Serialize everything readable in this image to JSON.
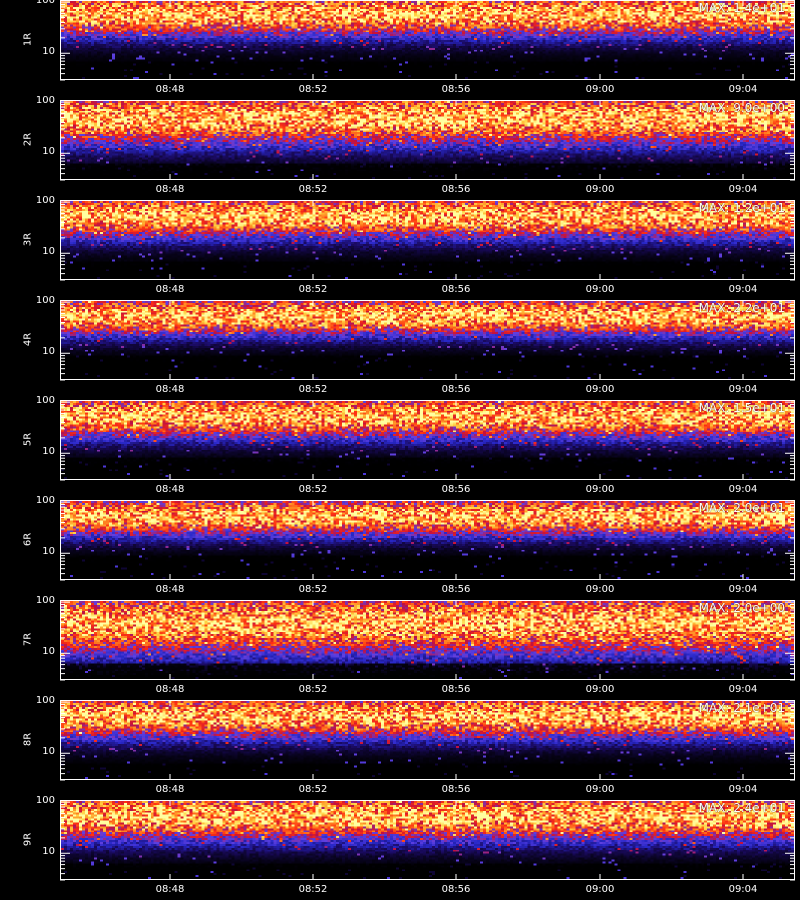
{
  "chart_data": {
    "type": "heatmap",
    "x_tick_labels": [
      "08:48",
      "08:52",
      "08:56",
      "09:00",
      "09:04"
    ],
    "x_range": [
      "08:44:20",
      "09:06:50"
    ],
    "y_scale": "log",
    "y_tick_labels": [
      "100",
      "10"
    ],
    "y_range": [
      3,
      110
    ],
    "colormap": [
      "#000000",
      "#1a0a60",
      "#2828c8",
      "#6040e0",
      "#c01040",
      "#ff3010",
      "#ff8020",
      "#ffd040",
      "#ffffa0"
    ],
    "panels": [
      {
        "label": "1R",
        "max_text": "MAX: 1.4e+01",
        "band_center": 60,
        "band_spread": 0.45,
        "low_cut": 7
      },
      {
        "label": "2R",
        "max_text": "MAX: 9.0e+00",
        "band_center": 50,
        "band_spread": 0.55,
        "low_cut": 6
      },
      {
        "label": "3R",
        "max_text": "MAX: 1.2e+01",
        "band_center": 55,
        "band_spread": 0.45,
        "low_cut": 7
      },
      {
        "label": "4R",
        "max_text": "MAX: 2.2e+01",
        "band_center": 55,
        "band_spread": 0.4,
        "low_cut": 9
      },
      {
        "label": "5R",
        "max_text": "MAX: 1.5e+01",
        "band_center": 55,
        "band_spread": 0.45,
        "low_cut": 8
      },
      {
        "label": "6R",
        "max_text": "MAX: 2.0e+01",
        "band_center": 55,
        "band_spread": 0.4,
        "low_cut": 9
      },
      {
        "label": "7R",
        "max_text": "MAX: 2.0e+00",
        "band_center": 40,
        "band_spread": 0.65,
        "low_cut": 6
      },
      {
        "label": "8R",
        "max_text": "MAX: 2.1e+01",
        "band_center": 55,
        "band_spread": 0.45,
        "low_cut": 6
      },
      {
        "label": "9R",
        "max_text": "MAX: 2.4e+01",
        "band_center": 55,
        "band_spread": 0.5,
        "low_cut": 6
      }
    ]
  }
}
